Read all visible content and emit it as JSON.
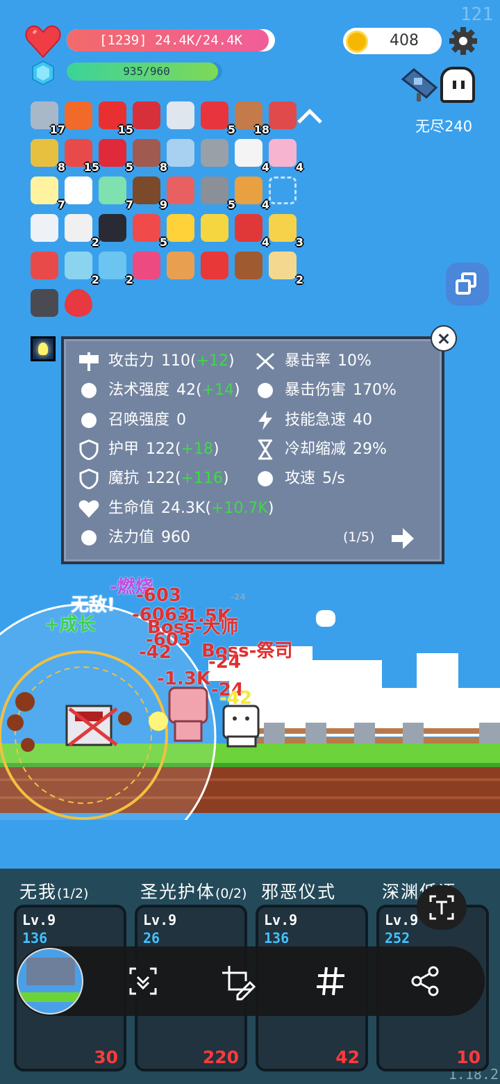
{
  "hud": {
    "fps": "121",
    "hp_text": "[1239] 24.4K/24.4K",
    "hp_fraction": 0.97,
    "mp_text": "935/960",
    "mp_fraction": 0.974,
    "coins": "408",
    "mode_label": "无尽240"
  },
  "items": [
    {
      "icon": "sword-icon",
      "count": "17"
    },
    {
      "icon": "fire-ring-icon",
      "count": ""
    },
    {
      "icon": "apple-icon",
      "count": "15"
    },
    {
      "icon": "magnet-icon",
      "count": ""
    },
    {
      "icon": "dagger-icon",
      "count": ""
    },
    {
      "icon": "bookmark-icon",
      "count": "5"
    },
    {
      "icon": "shield-round-icon",
      "count": "18"
    },
    {
      "icon": "badge-shield-icon",
      "count": ""
    },
    {
      "icon": "pineapple-icon",
      "count": "8"
    },
    {
      "icon": "watermelon-icon",
      "count": "15"
    },
    {
      "icon": "strawberry-icon",
      "count": "5"
    },
    {
      "icon": "tombstone-icon",
      "count": "8"
    },
    {
      "icon": "robe-icon",
      "count": ""
    },
    {
      "icon": "viking-helmet-icon",
      "count": ""
    },
    {
      "icon": "dice-icon",
      "count": "4"
    },
    {
      "icon": "ice-cream-icon",
      "count": "4"
    },
    {
      "icon": "flower-icon",
      "count": "7"
    },
    {
      "icon": "checklist-icon",
      "count": ""
    },
    {
      "icon": "syringe-icon",
      "count": "7"
    },
    {
      "icon": "coconut-icon",
      "count": "9"
    },
    {
      "icon": "bacon-icon",
      "count": ""
    },
    {
      "icon": "spiked-ball-icon",
      "count": "5"
    },
    {
      "icon": "book-icon",
      "count": "4"
    },
    {
      "icon": "empty-slot-icon",
      "count": ""
    },
    {
      "icon": "envelope-icon",
      "count": ""
    },
    {
      "icon": "cards-icon",
      "count": "2"
    },
    {
      "icon": "cauldron-icon",
      "count": ""
    },
    {
      "icon": "pill-icon",
      "count": "5"
    },
    {
      "icon": "sun-orb-icon",
      "count": ""
    },
    {
      "icon": "battery-icon",
      "count": ""
    },
    {
      "icon": "sock-icon",
      "count": "4"
    },
    {
      "icon": "cheese-icon",
      "count": "3"
    },
    {
      "icon": "sneaker-icon",
      "count": ""
    },
    {
      "icon": "potion-icon",
      "count": "2"
    },
    {
      "icon": "snowflake-icon",
      "count": "2"
    },
    {
      "icon": "flame-icon",
      "count": ""
    },
    {
      "icon": "card-case-icon",
      "count": ""
    },
    {
      "icon": "gift-icon",
      "count": ""
    },
    {
      "icon": "meat-icon",
      "count": ""
    },
    {
      "icon": "map-icon",
      "count": "2"
    },
    {
      "icon": "hand-icon",
      "count": ""
    },
    {
      "icon": "heart-icon",
      "count": ""
    }
  ],
  "stats": {
    "left": [
      {
        "icon": "axe-icon",
        "label": "攻击力",
        "value": "110(",
        "bonus": "+12",
        "close": ")"
      },
      {
        "icon": "sun-icon",
        "label": "法术强度",
        "value": "42(",
        "bonus": "+14",
        "close": ")"
      },
      {
        "icon": "summon-icon",
        "label": "召唤强度",
        "value": "0",
        "bonus": "",
        "close": ""
      },
      {
        "icon": "armor-icon",
        "label": "护甲",
        "value": "122(",
        "bonus": "+18",
        "close": ")"
      },
      {
        "icon": "magic-resist-icon",
        "label": "魔抗",
        "value": "122(",
        "bonus": "+116",
        "close": ")"
      },
      {
        "icon": "heart-icon",
        "label": "生命值",
        "value": "24.3K(",
        "bonus": "+10.7K",
        "close": ")"
      },
      {
        "icon": "mana-gem-icon",
        "label": "法力值",
        "value": "960",
        "bonus": "",
        "close": ""
      }
    ],
    "right": [
      {
        "icon": "crit-icon",
        "label": "暴击率",
        "value": "10%"
      },
      {
        "icon": "crit-damage-icon",
        "label": "暴击伤害",
        "value": "170%"
      },
      {
        "icon": "lightning-icon",
        "label": "技能急速",
        "value": "40"
      },
      {
        "icon": "hourglass-icon",
        "label": "冷却缩减",
        "value": "29%"
      },
      {
        "icon": "attack-speed-icon",
        "label": "攻速",
        "value": "5/s"
      }
    ],
    "page": "(1/5)"
  },
  "battle": {
    "floaters": [
      {
        "text": "-燃烧",
        "color": "#c44ae0"
      },
      {
        "text": "-603",
        "color": "#e03030"
      },
      {
        "text": "无敌!",
        "color": "#ffffff"
      },
      {
        "text": "-6063",
        "color": "#e03030"
      },
      {
        "text": "-1.5K",
        "color": "#e03030"
      },
      {
        "text": "+成长",
        "color": "#39d24b"
      },
      {
        "text": "Boss-大师",
        "color": "#e03030"
      },
      {
        "text": "-42",
        "color": "#e03030"
      },
      {
        "text": "-603",
        "color": "#e03030"
      },
      {
        "text": "Boss-祭司",
        "color": "#e03030"
      },
      {
        "text": "-24",
        "color": "#e03030"
      },
      {
        "text": "-1.3K",
        "color": "#e03030"
      },
      {
        "text": "-24",
        "color": "#e03030"
      },
      {
        "text": "-42",
        "color": "#f3e93a"
      },
      {
        "text": "-24",
        "color": "#7fa8c8"
      }
    ]
  },
  "skills": [
    {
      "title": "无我",
      "sub": "(1/2)",
      "level": "Lv.9",
      "value": "136",
      "cost": "30"
    },
    {
      "title": "圣光护体",
      "sub": "(0/2)",
      "level": "Lv.9",
      "value": "26",
      "cost": "220"
    },
    {
      "title": "邪恶仪式",
      "sub": "",
      "level": "Lv.9",
      "value": "136",
      "cost": "42"
    },
    {
      "title": "深渊低语",
      "sub": "",
      "level": "Lv.9",
      "value": "252",
      "cost": "10"
    }
  ],
  "version": "1.18.2",
  "toolbar": {
    "buttons": [
      "scroll-capture-icon",
      "edit-crop-icon",
      "hashtag-icon",
      "share-icon"
    ]
  }
}
